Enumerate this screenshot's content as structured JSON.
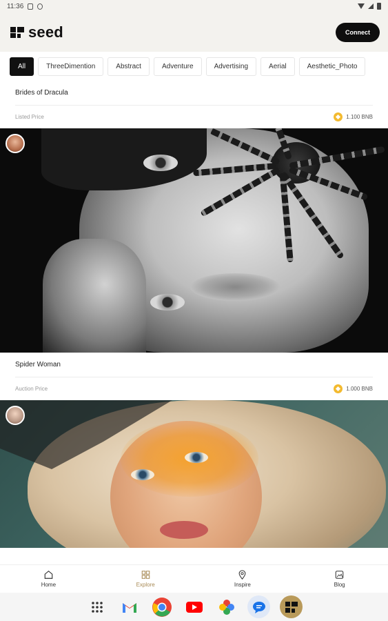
{
  "status_bar": {
    "time": "11:36"
  },
  "header": {
    "logo_text": "seed",
    "connect_label": "Connect"
  },
  "categories": [
    {
      "label": "All",
      "active": true
    },
    {
      "label": "ThreeDimention",
      "active": false
    },
    {
      "label": "Abstract",
      "active": false
    },
    {
      "label": "Adventure",
      "active": false
    },
    {
      "label": "Advertising",
      "active": false
    },
    {
      "label": "Aerial",
      "active": false
    },
    {
      "label": "Aesthetic_Photo",
      "active": false
    }
  ],
  "cards": [
    {
      "title": "Brides of Dracula",
      "price_label": "Listed Price",
      "price": "1.100 BNB"
    },
    {
      "title": "Spider Woman",
      "price_label": "Auction Price",
      "price": "1.000 BNB"
    }
  ],
  "bottom_nav": {
    "home": "Home",
    "explore": "Explore",
    "inspire": "Inspire",
    "blog": "Blog"
  },
  "colors": {
    "accent": "#a88a55",
    "coin": "#f3ba2f",
    "dark": "#0e0e0e",
    "header_bg": "#f3f2ee"
  }
}
